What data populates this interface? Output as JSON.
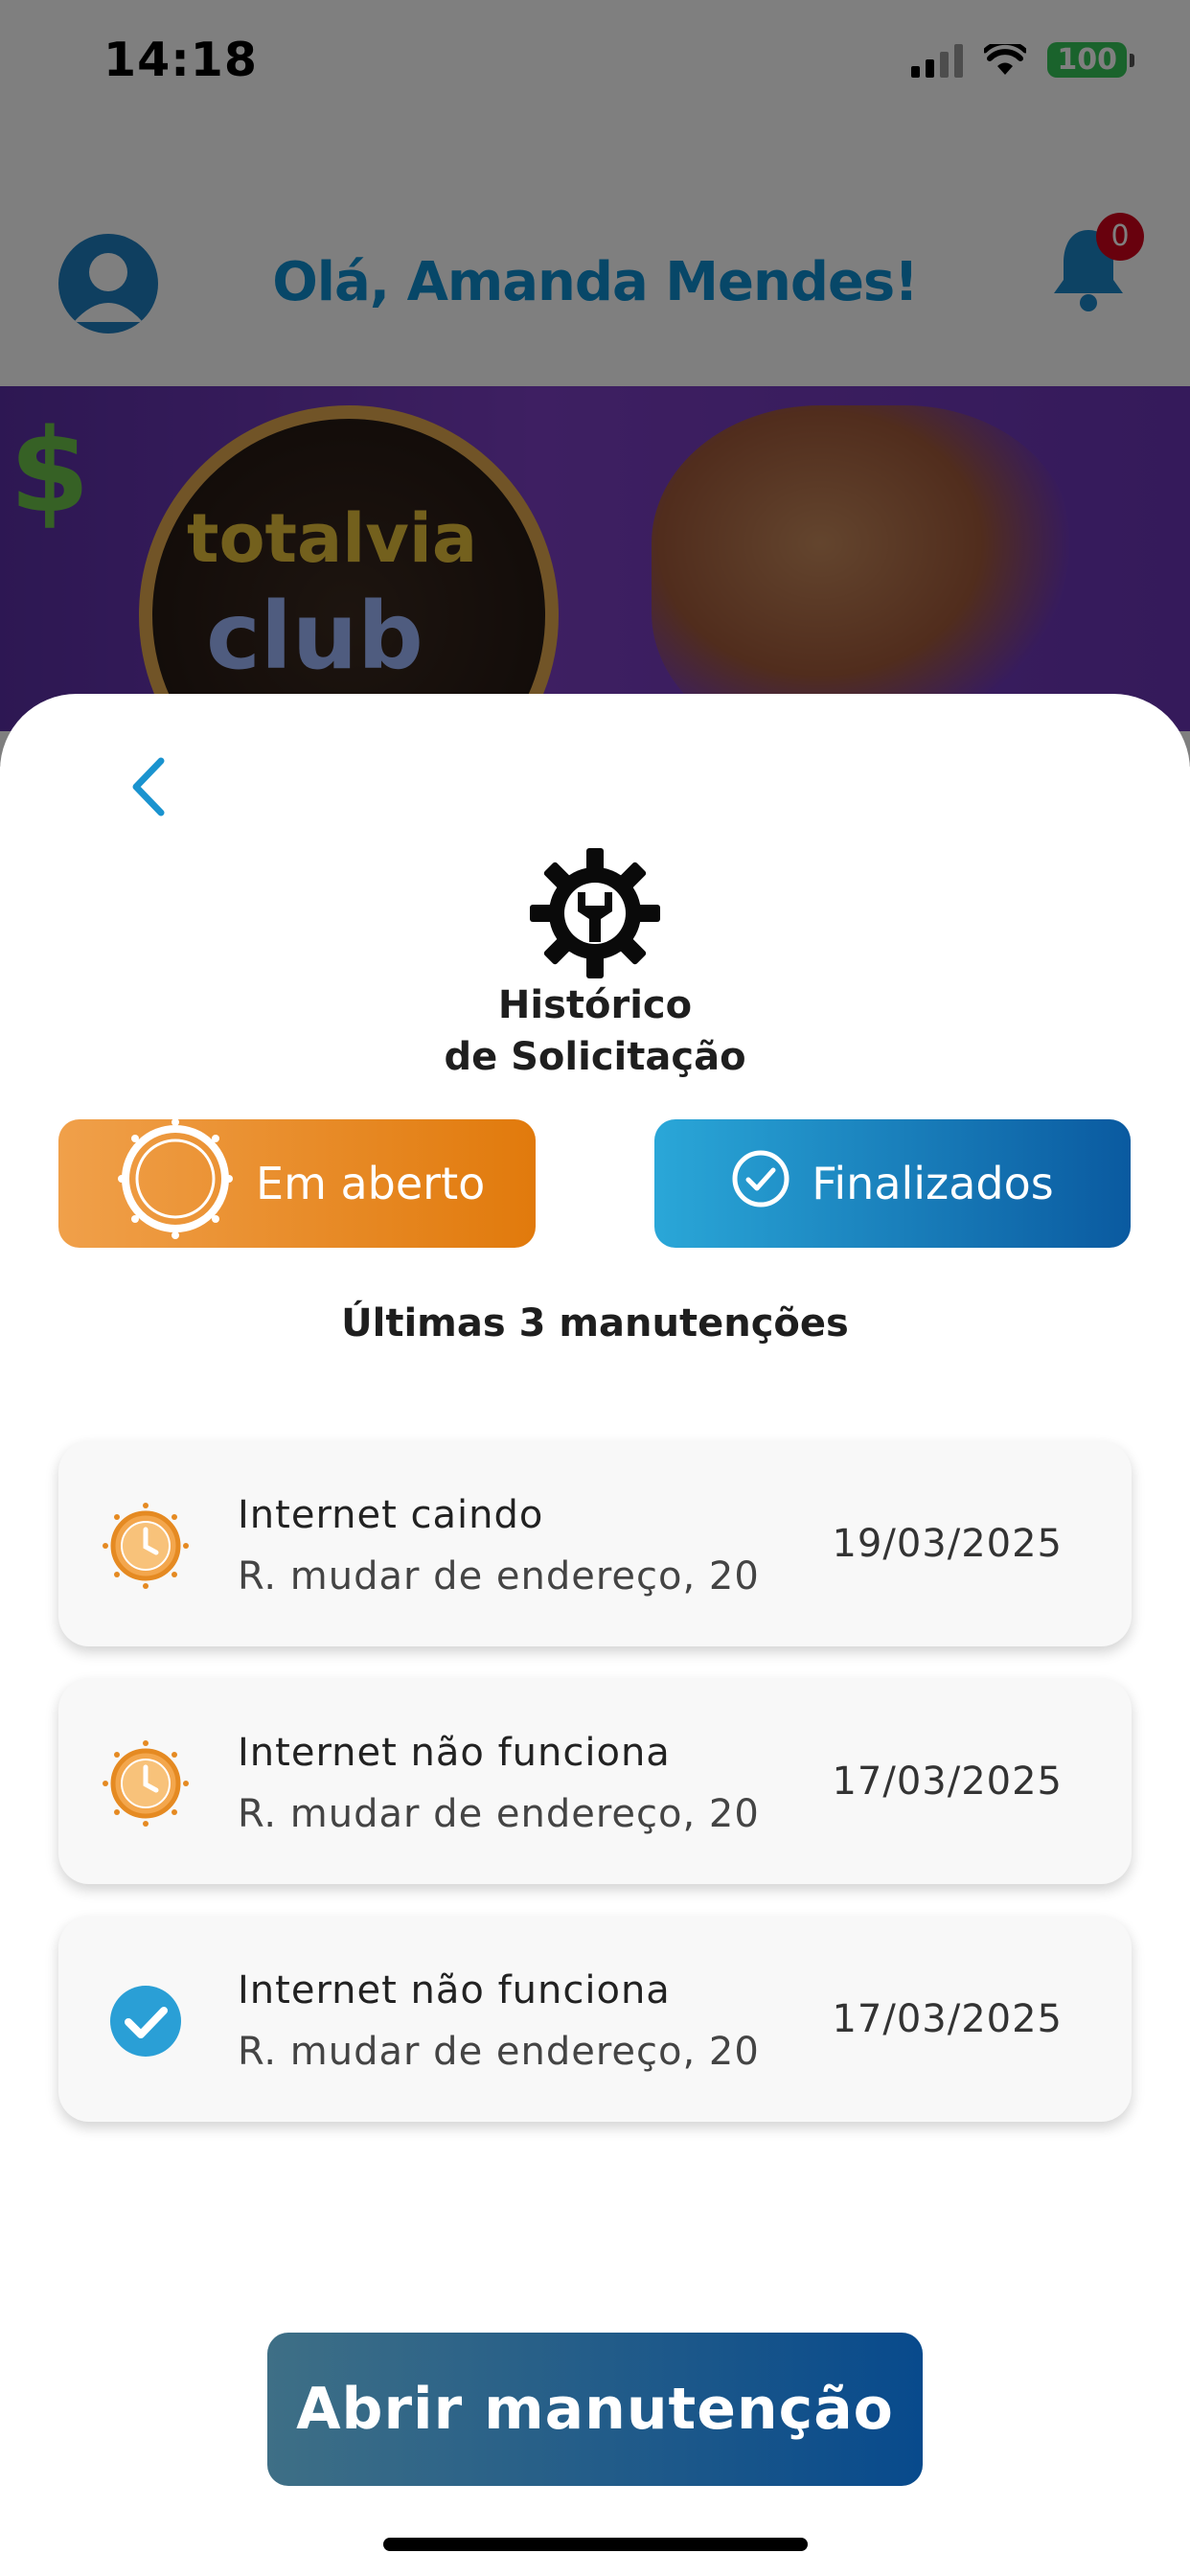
{
  "status_bar": {
    "time": "14:18",
    "battery": "100"
  },
  "header": {
    "greeting": "Olá, Amanda Mendes!",
    "notifications_count": "0"
  },
  "banner": {
    "brand_line1": "totalvia",
    "brand_line2": "club"
  },
  "sheet": {
    "title_line1": "Histórico",
    "title_line2": "de Solicitação",
    "tabs": {
      "open_label": "Em aberto",
      "done_label": "Finalizados"
    },
    "subtitle": "Últimas 3 manutenções",
    "requests": [
      {
        "title": "Internet caindo",
        "address": "R. mudar de endereço, 20",
        "date": "19/03/2025",
        "status": "open",
        "icon": "clock-icon"
      },
      {
        "title": "Internet não funciona",
        "address": "R. mudar de endereço, 20",
        "date": "17/03/2025",
        "status": "open",
        "icon": "clock-icon"
      },
      {
        "title": "Internet não funciona",
        "address": "R. mudar de endereço, 20",
        "date": "17/03/2025",
        "status": "done",
        "icon": "check-circle-icon"
      }
    ],
    "cta_label": "Abrir manutenção"
  },
  "colors": {
    "open_accent": "#e88a24",
    "done_accent": "#2a9fd6",
    "header_title": "#0f8fd0"
  }
}
